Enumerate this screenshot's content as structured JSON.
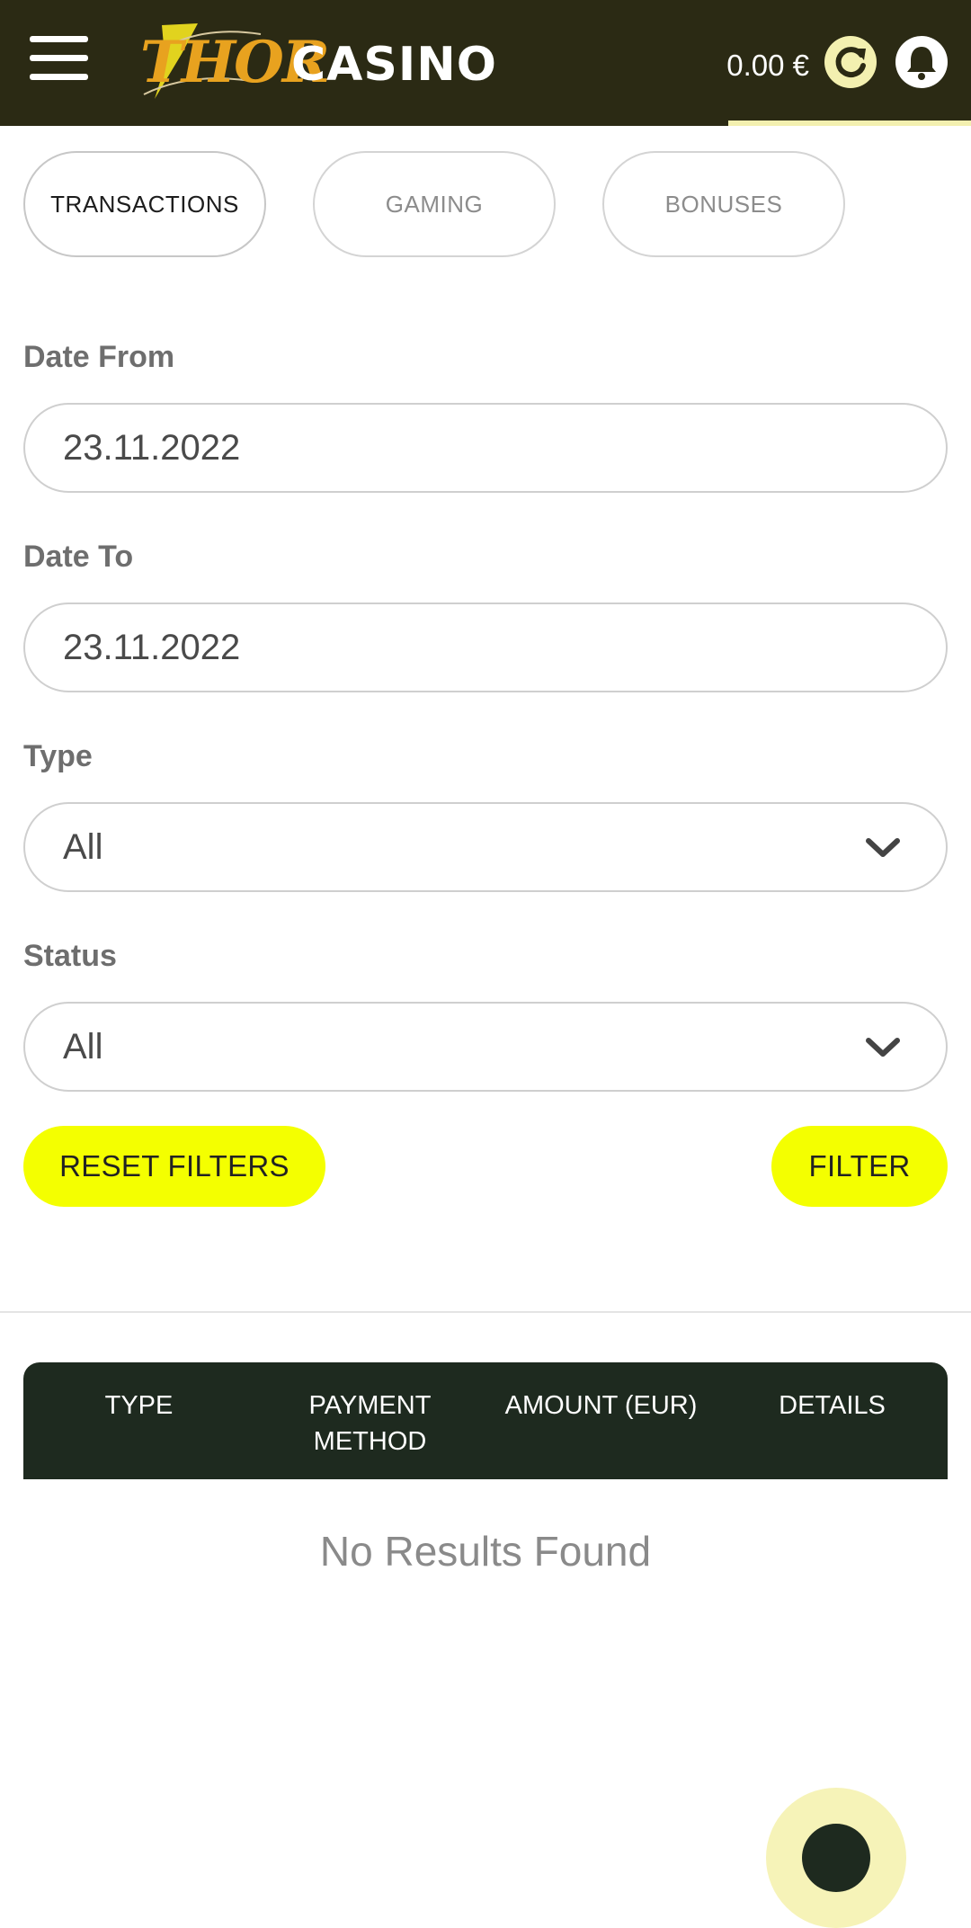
{
  "header": {
    "logo_word1": "THOR",
    "logo_word2": "CASINO",
    "balance": "0.00 €",
    "icons": [
      "menu-icon",
      "refresh-icon",
      "bell-icon"
    ]
  },
  "tabs": [
    {
      "label": "TRANSACTIONS",
      "active": true
    },
    {
      "label": "GAMING",
      "active": false
    },
    {
      "label": "BONUSES",
      "active": false
    }
  ],
  "filters": {
    "date_from": {
      "label": "Date From",
      "value": "23.11.2022"
    },
    "date_to": {
      "label": "Date To",
      "value": "23.11.2022"
    },
    "type": {
      "label": "Type",
      "value": "All"
    },
    "status": {
      "label": "Status",
      "value": "All"
    }
  },
  "buttons": {
    "reset": "RESET FILTERS",
    "filter": "FILTER"
  },
  "table": {
    "columns": [
      "TYPE",
      "PAYMENT\nMETHOD",
      "AMOUNT (EUR)",
      "DETAILS"
    ],
    "empty_text": "No Results Found"
  },
  "colors": {
    "header_bg": "#2b2a14",
    "accent_yellow": "#f4ff00",
    "table_header_bg": "#1e2a1f"
  }
}
